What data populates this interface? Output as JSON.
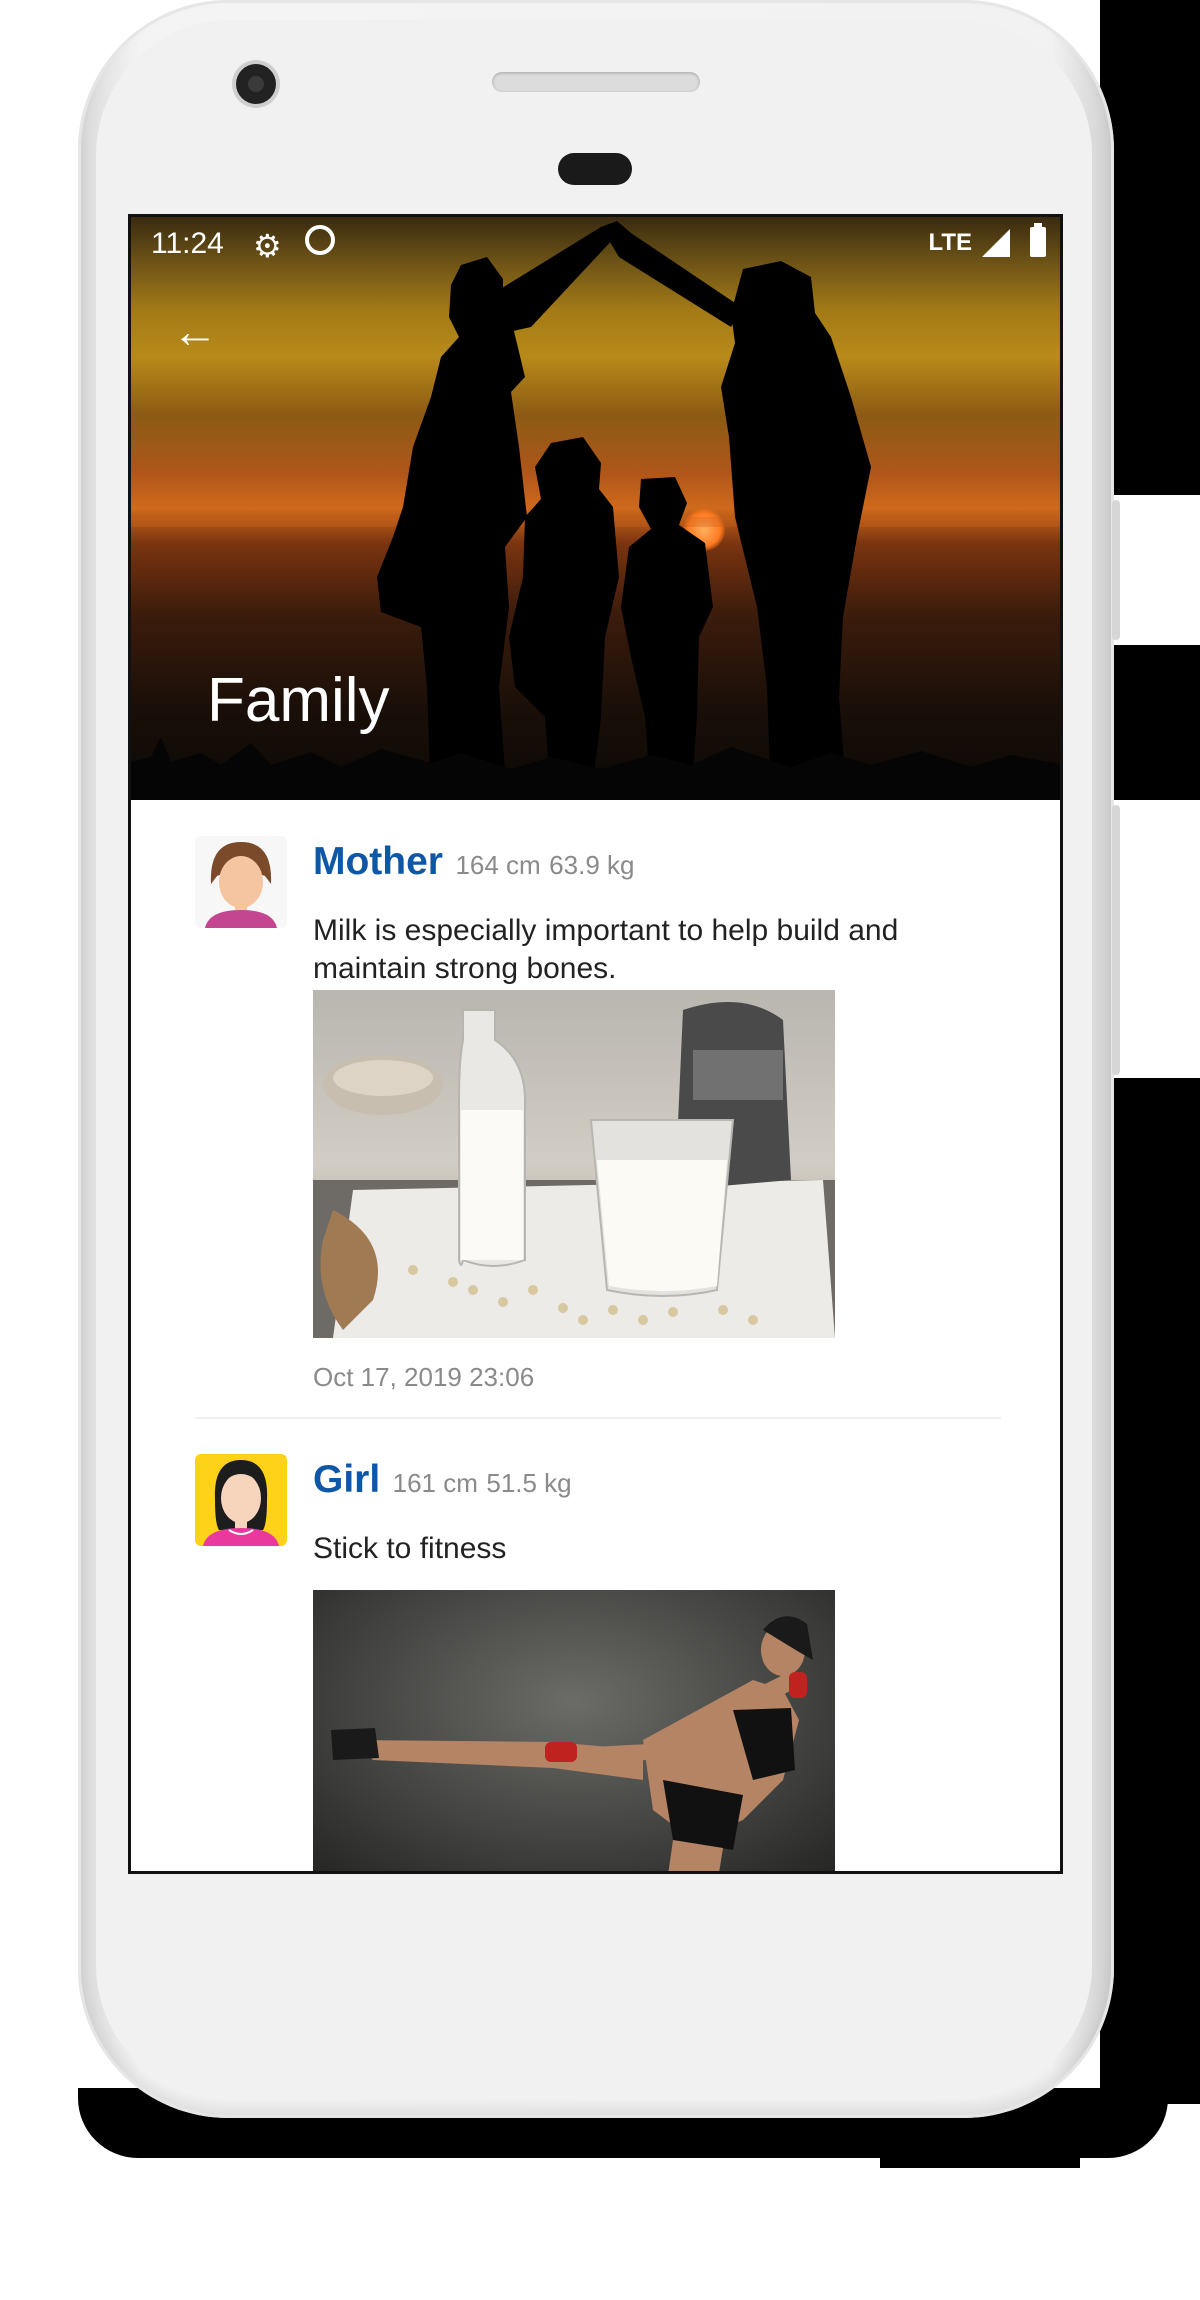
{
  "status_bar": {
    "time": "11:24",
    "network": "LTE",
    "icons": [
      "gear-icon",
      "sync-icon",
      "signal-icon",
      "battery-icon"
    ]
  },
  "header": {
    "title": "Family",
    "back_icon": "arrow-left-icon"
  },
  "feed": [
    {
      "name": "Mother",
      "height": "164 cm",
      "weight": "63.9 kg",
      "text": "Milk is especially important to help build and maintain strong bones.",
      "image": "milk-photo",
      "timestamp": "Oct 17, 2019 23:06",
      "avatar": "mother-avatar"
    },
    {
      "name": "Girl",
      "height": "161 cm",
      "weight": "51.5 kg",
      "text": "Stick to fitness",
      "image": "kickboxing-photo",
      "avatar": "girl-avatar"
    }
  ],
  "colors": {
    "name_blue": "#0e56a6",
    "meta_gray": "#8a8a8a",
    "text_dark": "#222222"
  }
}
